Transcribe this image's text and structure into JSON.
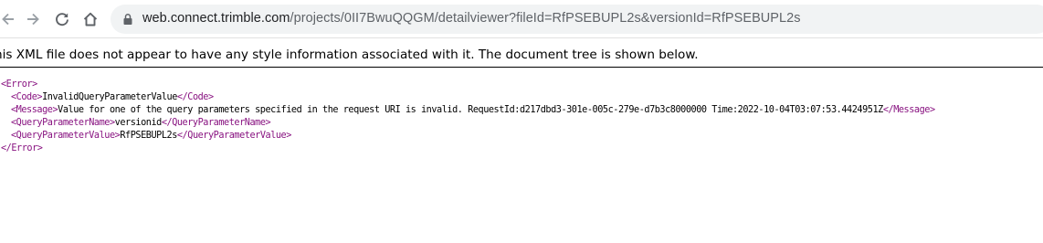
{
  "browser": {
    "url_host": "web.connect.trimble.com",
    "url_rest": "/projects/0II7BwuQQGM/detailviewer?fileId=RfPSEBUPL2s&versionId=RfPSEBUPL2s"
  },
  "notice": "his XML file does not appear to have any style information associated with it. The document tree is shown below.",
  "xml": {
    "error_open": "<Error>",
    "error_close": "</Error>",
    "code_open": "<Code>",
    "code_value": "InvalidQueryParameterValue",
    "code_close": "</Code>",
    "message_open": "<Message>",
    "message_value": "Value for one of the query parameters specified in the request URI is invalid. RequestId:d217dbd3-301e-005c-279e-d7b3c8000000 Time:2022-10-04T03:07:53.4424951Z",
    "message_close": "</Message>",
    "qpn_open": "<QueryParameterName>",
    "qpn_value": "versionid",
    "qpn_close": "</QueryParameterName>",
    "qpv_open": "<QueryParameterValue>",
    "qpv_value": "RfPSEBUPL2s",
    "qpv_close": "</QueryParameterValue>"
  },
  "colors": {
    "tag": "#881280",
    "omnibox_bg": "#f1f3f4",
    "icon": "#5f6368"
  },
  "icons": [
    "back-arrow-icon",
    "forward-arrow-icon",
    "reload-icon",
    "home-icon",
    "lock-icon"
  ]
}
